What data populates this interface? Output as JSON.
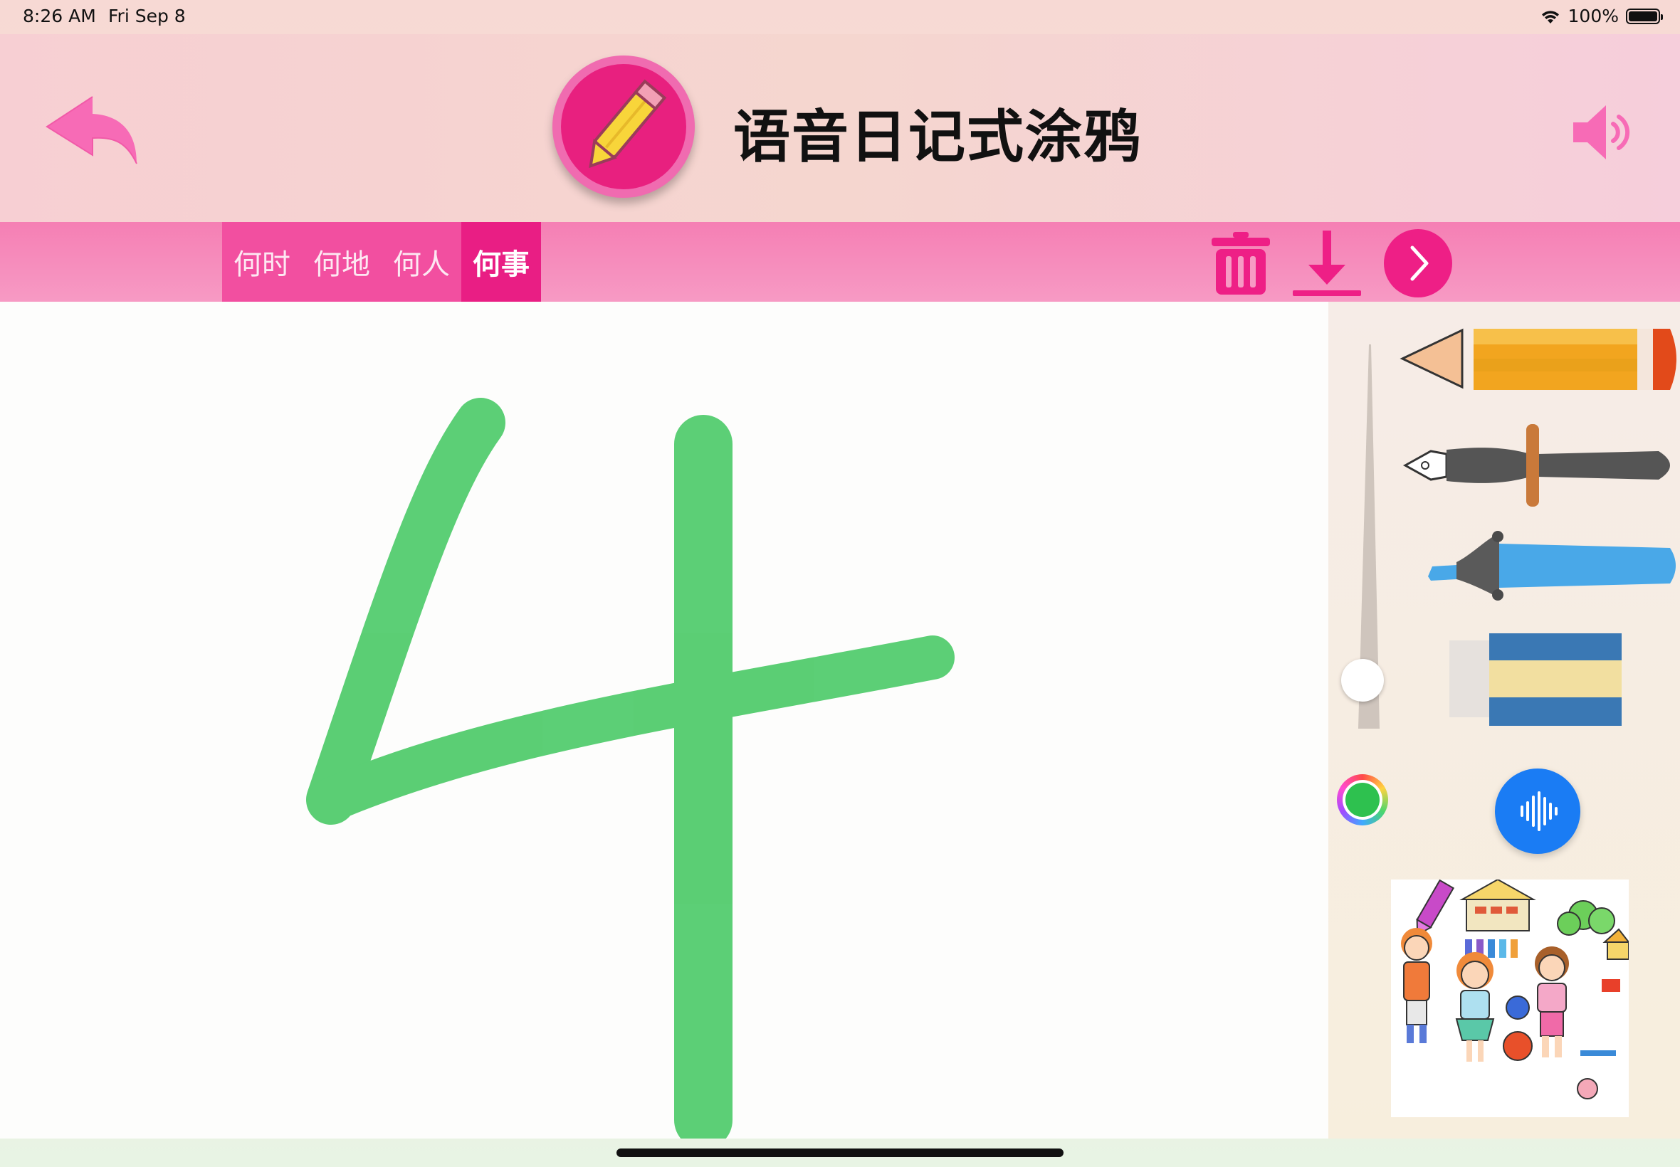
{
  "status": {
    "time": "8:26 AM",
    "date": "Fri Sep 8",
    "battery": "100%",
    "icons": [
      "wifi-icon",
      "battery-icon"
    ]
  },
  "header": {
    "title": "语音日记式涂鸦",
    "back_icon": "back-arrow-icon",
    "app_icon": "pencil-icon",
    "sound_icon": "speaker-icon"
  },
  "tabs": [
    {
      "label": "何时",
      "active": false
    },
    {
      "label": "何地",
      "active": false
    },
    {
      "label": "何人",
      "active": false
    },
    {
      "label": "何事",
      "active": true
    }
  ],
  "toolbar": {
    "icons": [
      "trash-icon",
      "download-icon",
      "chevron-right-icon"
    ]
  },
  "tools": {
    "items": [
      "pencil",
      "fountain-pen",
      "highlighter",
      "eraser"
    ],
    "brush_size": 0.88,
    "selected_color": "#2ec14f"
  },
  "colors": {
    "accent": "#e91e84",
    "tabbar": "#f57fb4",
    "mic": "#1a7cf4",
    "stroke": "#2ec14f"
  }
}
